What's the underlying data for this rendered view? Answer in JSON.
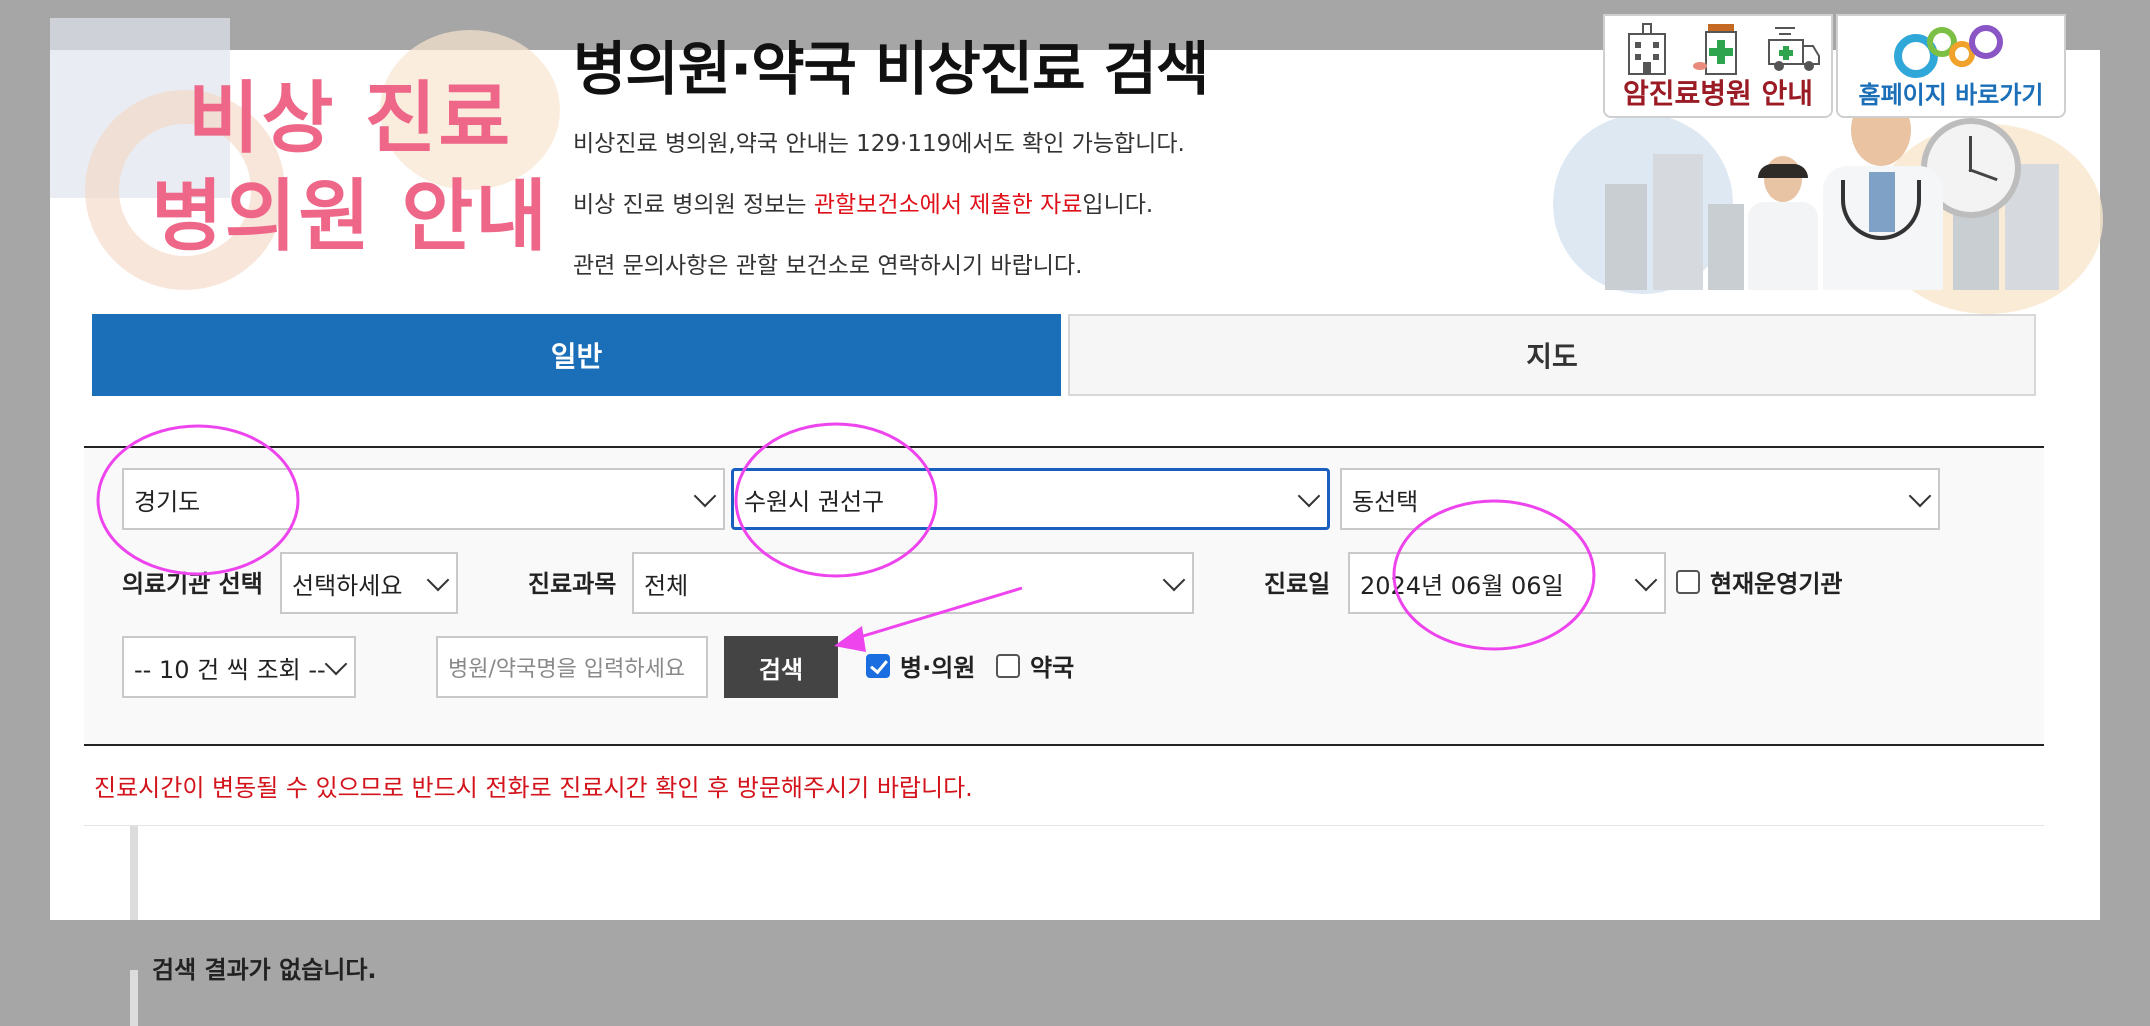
{
  "header": {
    "logo_line1": "비상 진료",
    "logo_line2": "병의원 안내",
    "title": "병의원·약국 비상진료 검색",
    "info1": "비상진료 병의원,약국 안내는 129·119에서도 확인 가능합니다.",
    "info2_prefix": "비상 진료 병의원 정보는 ",
    "info2_highlight": "관할보건소에서 제출한 자료",
    "info2_suffix": "입니다.",
    "info3": "관련 문의사항은 관할 보건소로 연락하시기 바랍니다.",
    "cancer_label": "암진료병원 안내",
    "home_label": "홈페이지 바로가기"
  },
  "tabs": [
    {
      "label": "일반",
      "active": true
    },
    {
      "label": "지도",
      "active": false
    }
  ],
  "search": {
    "province": "경기도",
    "district": "수원시 권선구",
    "dong": "동선택",
    "institution_label": "의료기관 선택",
    "institution_value": "선택하세요",
    "department_label": "진료과목",
    "department_value": "전체",
    "date_label": "진료일",
    "date_value": "2024년 06월 06일",
    "operating_label": "현재운영기관",
    "operating_checked": false,
    "page_size": "-- 10 건 씩 조회 --",
    "name_placeholder": "병원/약국명을 입력하세요",
    "search_button": "검색",
    "hospital_label": "병·의원",
    "hospital_checked": true,
    "pharmacy_label": "약국",
    "pharmacy_checked": false
  },
  "notice": "진료시간이 변동될 수 있으므로 반드시 전화로 진료시간 확인 후 방문해주시기 바랍니다.",
  "results": {
    "empty_text": "검색 결과가 없습니다."
  },
  "colors": {
    "accent": "#1a6fb8",
    "annotation": "#ee44ee",
    "notice": "#d3141c"
  }
}
